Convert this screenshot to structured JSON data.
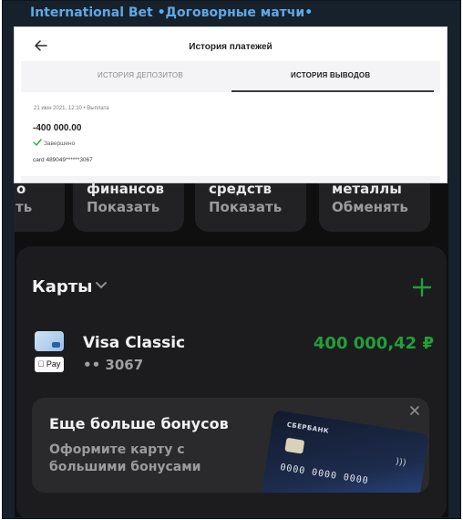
{
  "channel": {
    "title": "International Bet •Договорные матчи•"
  },
  "payment_history": {
    "title": "История платежей",
    "tabs": [
      {
        "label": "ИСТОРИЯ ДЕПОЗИТОВ",
        "active": false
      },
      {
        "label": "ИСТОРИЯ ВЫВОДОВ",
        "active": true
      }
    ],
    "entry": {
      "date": "21 июн 2021, 12:10 • Выплата",
      "amount": "-400 000.00",
      "status": "Завершено",
      "card": "card 489049******3067"
    }
  },
  "tiles": [
    {
      "top": "о",
      "bottom": "ть"
    },
    {
      "top": "финансов",
      "bottom": "Показать"
    },
    {
      "top": "средств",
      "bottom": "Показать"
    },
    {
      "top": "металлы",
      "bottom": "Обменять"
    }
  ],
  "cards_section": {
    "title": "Карты",
    "card": {
      "name": "Visa Classic",
      "number": "•• 3067",
      "balance": "400 000,42 ₽",
      "pay_badge": "Pay"
    }
  },
  "promo": {
    "title": "Еще больше бонусов",
    "text": "Оформите карту с большими бонусами",
    "card_brand": "СБЕРБАНК",
    "card_number": "0000 0000 0000"
  },
  "colors": {
    "accent_green": "#21a038",
    "link_blue": "#5fa8e8"
  },
  "icons": [
    "back-arrow-icon",
    "check-icon",
    "chevron-down-icon",
    "plus-icon",
    "close-icon",
    "apple-icon",
    "nfc-icon"
  ]
}
